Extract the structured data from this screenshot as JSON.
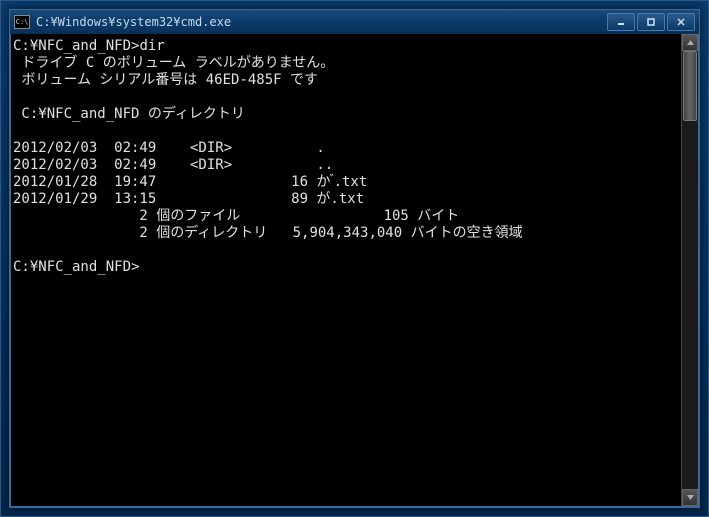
{
  "window": {
    "title": "C:¥Windows¥system32¥cmd.exe",
    "icon_label": "C:\\"
  },
  "controls": {
    "minimize": "Minimize",
    "maximize": "Maximize",
    "close": "Close"
  },
  "console": {
    "prompt1": "C:¥NFC_and_NFD>",
    "command1": "dir",
    "line_volume": " ドライブ C のボリューム ラベルがありません。",
    "line_serial": " ボリューム シリアル番号は 46ED-485F です",
    "line_dirof": " C:¥NFC_and_NFD のディレクトリ",
    "entries": [
      {
        "row": "2012/02/03  02:49    <DIR>          ."
      },
      {
        "row": "2012/02/03  02:49    <DIR>          .."
      },
      {
        "row": "2012/01/28  19:47                16 か ゙.txt"
      },
      {
        "row": "2012/01/29  13:15                89 が.txt"
      }
    ],
    "summary_files": "               2 個のファイル                 105 バイト",
    "summary_dirs": "               2 個のディレクトリ   5,904,343,040 バイトの空き領域",
    "prompt2": "C:¥NFC_and_NFD>"
  }
}
